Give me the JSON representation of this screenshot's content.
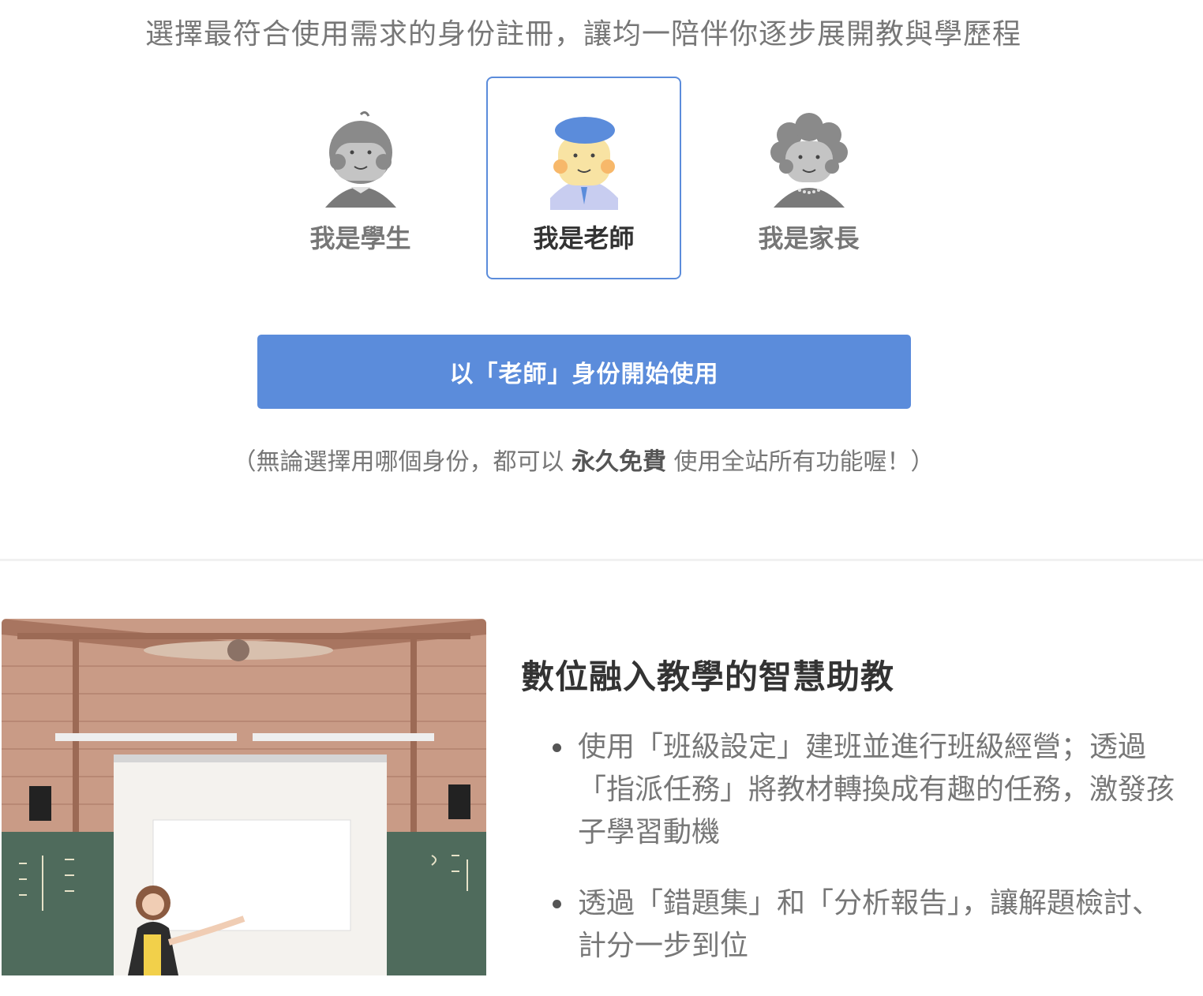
{
  "intro": "選擇最符合使用需求的身份註冊，讓均一陪伴你逐步展開教與學歷程",
  "roles": [
    {
      "label": "我是學生",
      "selected": false
    },
    {
      "label": "我是老師",
      "selected": true
    },
    {
      "label": "我是家長",
      "selected": false
    }
  ],
  "cta_label": "以「老師」身份開始使用",
  "note": {
    "before": "（無論選擇用哪個身份，都可以 ",
    "bold": "永久免費",
    "after": " 使用全站所有功能喔！）"
  },
  "feature": {
    "title": "數位融入教學的智慧助教",
    "items": [
      "使用「班級設定」建班並進行班級經營；透過「指派任務」將教材轉換成有趣的任務，激發孩子學習動機",
      "透過「錯題集」和「分析報告」，讓解題檢討、計分一步到位"
    ]
  },
  "colors": {
    "accent": "#5b8cdb",
    "teacher_hat": "#5b8cdb",
    "teacher_cheek": "#f7c86a",
    "avatar_gray": "#8a8a8a"
  }
}
